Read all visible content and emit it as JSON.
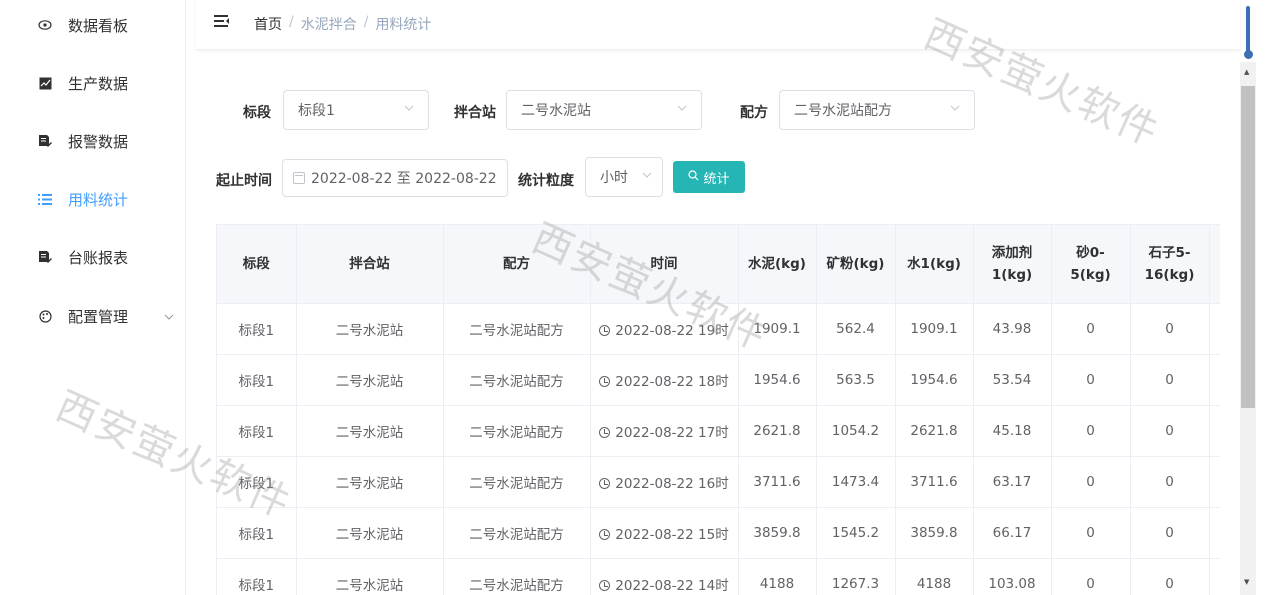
{
  "sidebar": {
    "items": [
      {
        "label": "数据看板",
        "icon": "eye-icon"
      },
      {
        "label": "生产数据",
        "icon": "chart-icon"
      },
      {
        "label": "报警数据",
        "icon": "document-edit-icon"
      },
      {
        "label": "用料统计",
        "icon": "list-icon",
        "active": true
      },
      {
        "label": "台账报表",
        "icon": "document-edit-icon"
      },
      {
        "label": "配置管理",
        "icon": "palette-icon",
        "has_children": true
      }
    ]
  },
  "header": {
    "breadcrumb": [
      "首页",
      "水泥拌合",
      "用料统计"
    ]
  },
  "filters": {
    "section_label": "标段",
    "section_value": "标段1",
    "station_label": "拌合站",
    "station_value": "二号水泥站",
    "recipe_label": "配方",
    "recipe_value": "二号水泥站配方",
    "time_label": "起止时间",
    "time_value": "2022-08-22 至 2022-08-22",
    "granularity_label": "统计粒度",
    "granularity_value": "小时",
    "stat_button": "统计"
  },
  "table": {
    "headers": [
      "标段",
      "拌合站",
      "配方",
      "时间",
      "水泥(kg)",
      "矿粉(kg)",
      "水1(kg)",
      "添加剂1(kg)",
      "砂0-5(kg)",
      "石子5-16(kg)"
    ],
    "rows": [
      [
        "标段1",
        "二号水泥站",
        "二号水泥站配方",
        "2022-08-22 19时",
        "1909.1",
        "562.4",
        "1909.1",
        "43.98",
        "0",
        "0"
      ],
      [
        "标段1",
        "二号水泥站",
        "二号水泥站配方",
        "2022-08-22 18时",
        "1954.6",
        "563.5",
        "1954.6",
        "53.54",
        "0",
        "0"
      ],
      [
        "标段1",
        "二号水泥站",
        "二号水泥站配方",
        "2022-08-22 17时",
        "2621.8",
        "1054.2",
        "2621.8",
        "45.18",
        "0",
        "0"
      ],
      [
        "标段1",
        "二号水泥站",
        "二号水泥站配方",
        "2022-08-22 16时",
        "3711.6",
        "1473.4",
        "3711.6",
        "63.17",
        "0",
        "0"
      ],
      [
        "标段1",
        "二号水泥站",
        "二号水泥站配方",
        "2022-08-22 15时",
        "3859.8",
        "1545.2",
        "3859.8",
        "66.17",
        "0",
        "0"
      ],
      [
        "标段1",
        "二号水泥站",
        "二号水泥站配方",
        "2022-08-22 14时",
        "4188",
        "1267.3",
        "4188",
        "103.08",
        "0",
        "0"
      ]
    ]
  },
  "watermark": "西安萤火软件"
}
